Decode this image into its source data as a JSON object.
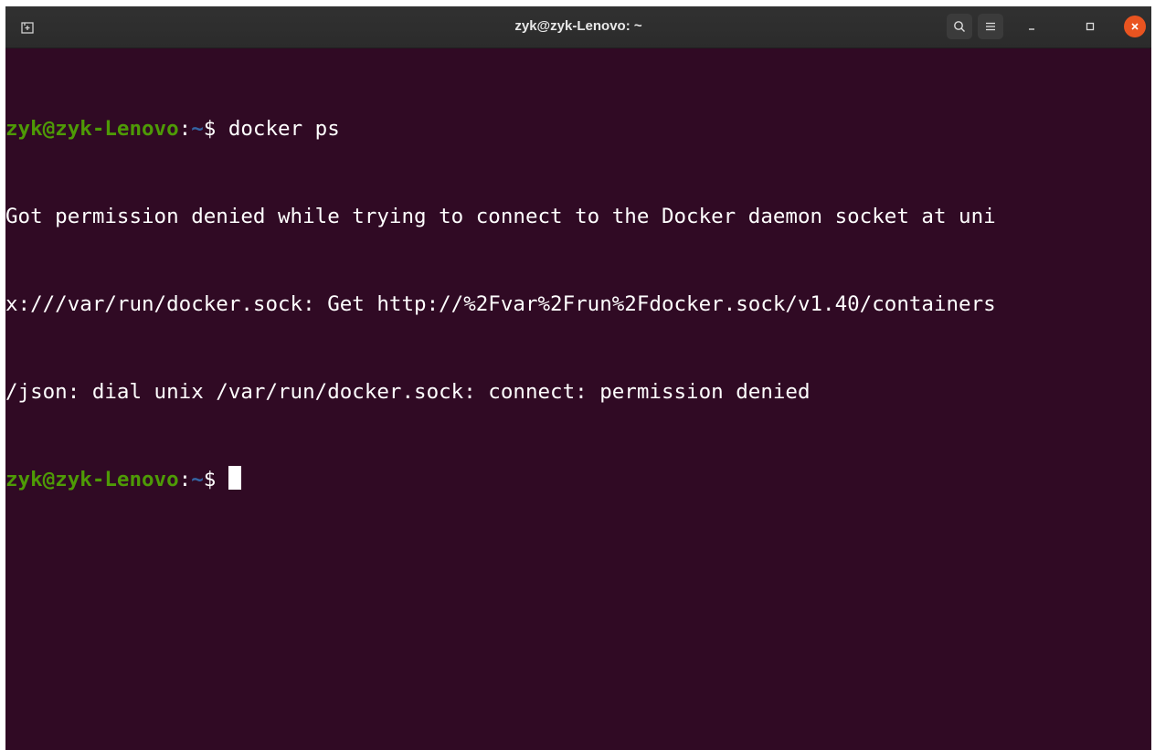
{
  "window": {
    "title": "zyk@zyk-Lenovo: ~",
    "colors": {
      "background": "#300a24",
      "prompt_user": "#4e9a06",
      "prompt_path": "#3465a4",
      "text": "#ffffff",
      "close_button": "#e95420"
    },
    "icons": {
      "new_tab": "new-tab-icon",
      "search": "search-icon",
      "menu": "hamburger-menu-icon",
      "minimize": "minimize-icon",
      "maximize": "maximize-icon",
      "close": "close-icon"
    }
  },
  "terminal": {
    "prompt": {
      "user_host": "zyk@zyk-Lenovo",
      "colon": ":",
      "path": "~",
      "dollar": "$ "
    },
    "command": "docker ps",
    "output_lines": [
      "Got permission denied while trying to connect to the Docker daemon socket at uni",
      "x:///var/run/docker.sock: Get http://%2Fvar%2Frun%2Fdocker.sock/v1.40/containers",
      "/json: dial unix /var/run/docker.sock: connect: permission denied"
    ]
  }
}
